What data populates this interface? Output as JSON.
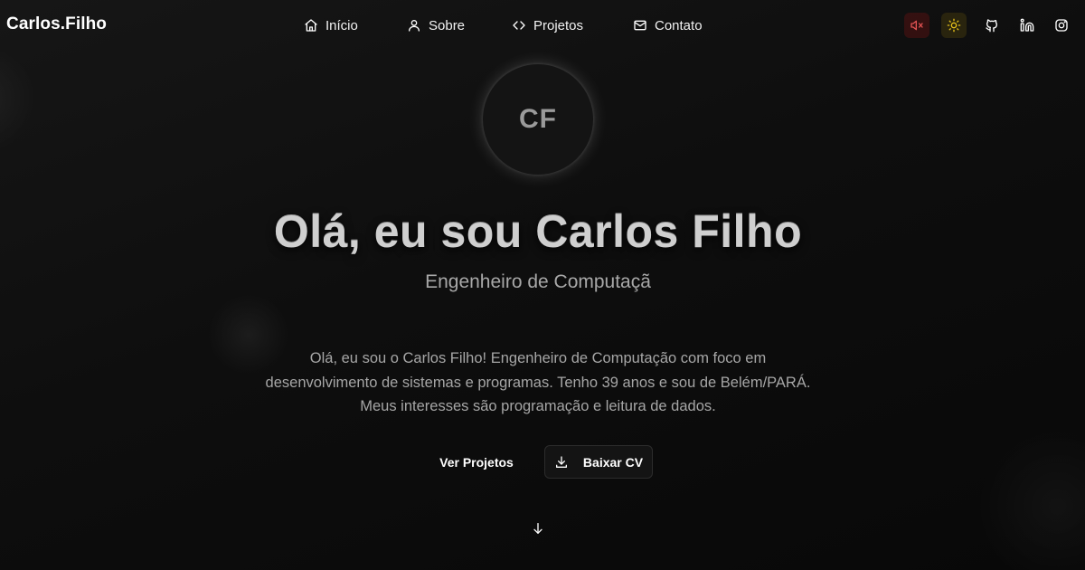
{
  "header": {
    "brand": "Carlos.Filho",
    "nav": [
      {
        "label": "Início",
        "icon": "home-icon"
      },
      {
        "label": "Sobre",
        "icon": "user-icon"
      },
      {
        "label": "Projetos",
        "icon": "code-icon"
      },
      {
        "label": "Contato",
        "icon": "mail-icon"
      }
    ],
    "tools": [
      {
        "icon": "volume-mute-icon",
        "color": "#e05252"
      },
      {
        "icon": "sun-icon",
        "color": "#e8c21a"
      },
      {
        "icon": "github-icon",
        "color": "#ffffff"
      },
      {
        "icon": "linkedin-icon",
        "color": "#ffffff"
      },
      {
        "icon": "instagram-icon",
        "color": "#ffffff"
      }
    ]
  },
  "hero": {
    "avatar_initials": "CF",
    "title": "Olá, eu sou Carlos Filho",
    "subtitle": "Engenheiro de Computaçã",
    "bio_lines": [
      "Olá, eu sou o Carlos Filho! Engenheiro de Computação com foco em",
      "desenvolvimento de sistemas e programas. Tenho 39 anos e sou de Belém/PARÁ.",
      "Meus interesses são programação e leitura de dados."
    ],
    "primary_button": "Ver Projetos",
    "secondary_button": "Baixar CV",
    "scroll_icon": "arrow-down-icon"
  },
  "colors": {
    "background": "#0b0b0b",
    "text": "#ffffff",
    "muted_text": "#a6a6a6",
    "mute_icon": "#e05252",
    "theme_icon": "#e8c21a"
  }
}
